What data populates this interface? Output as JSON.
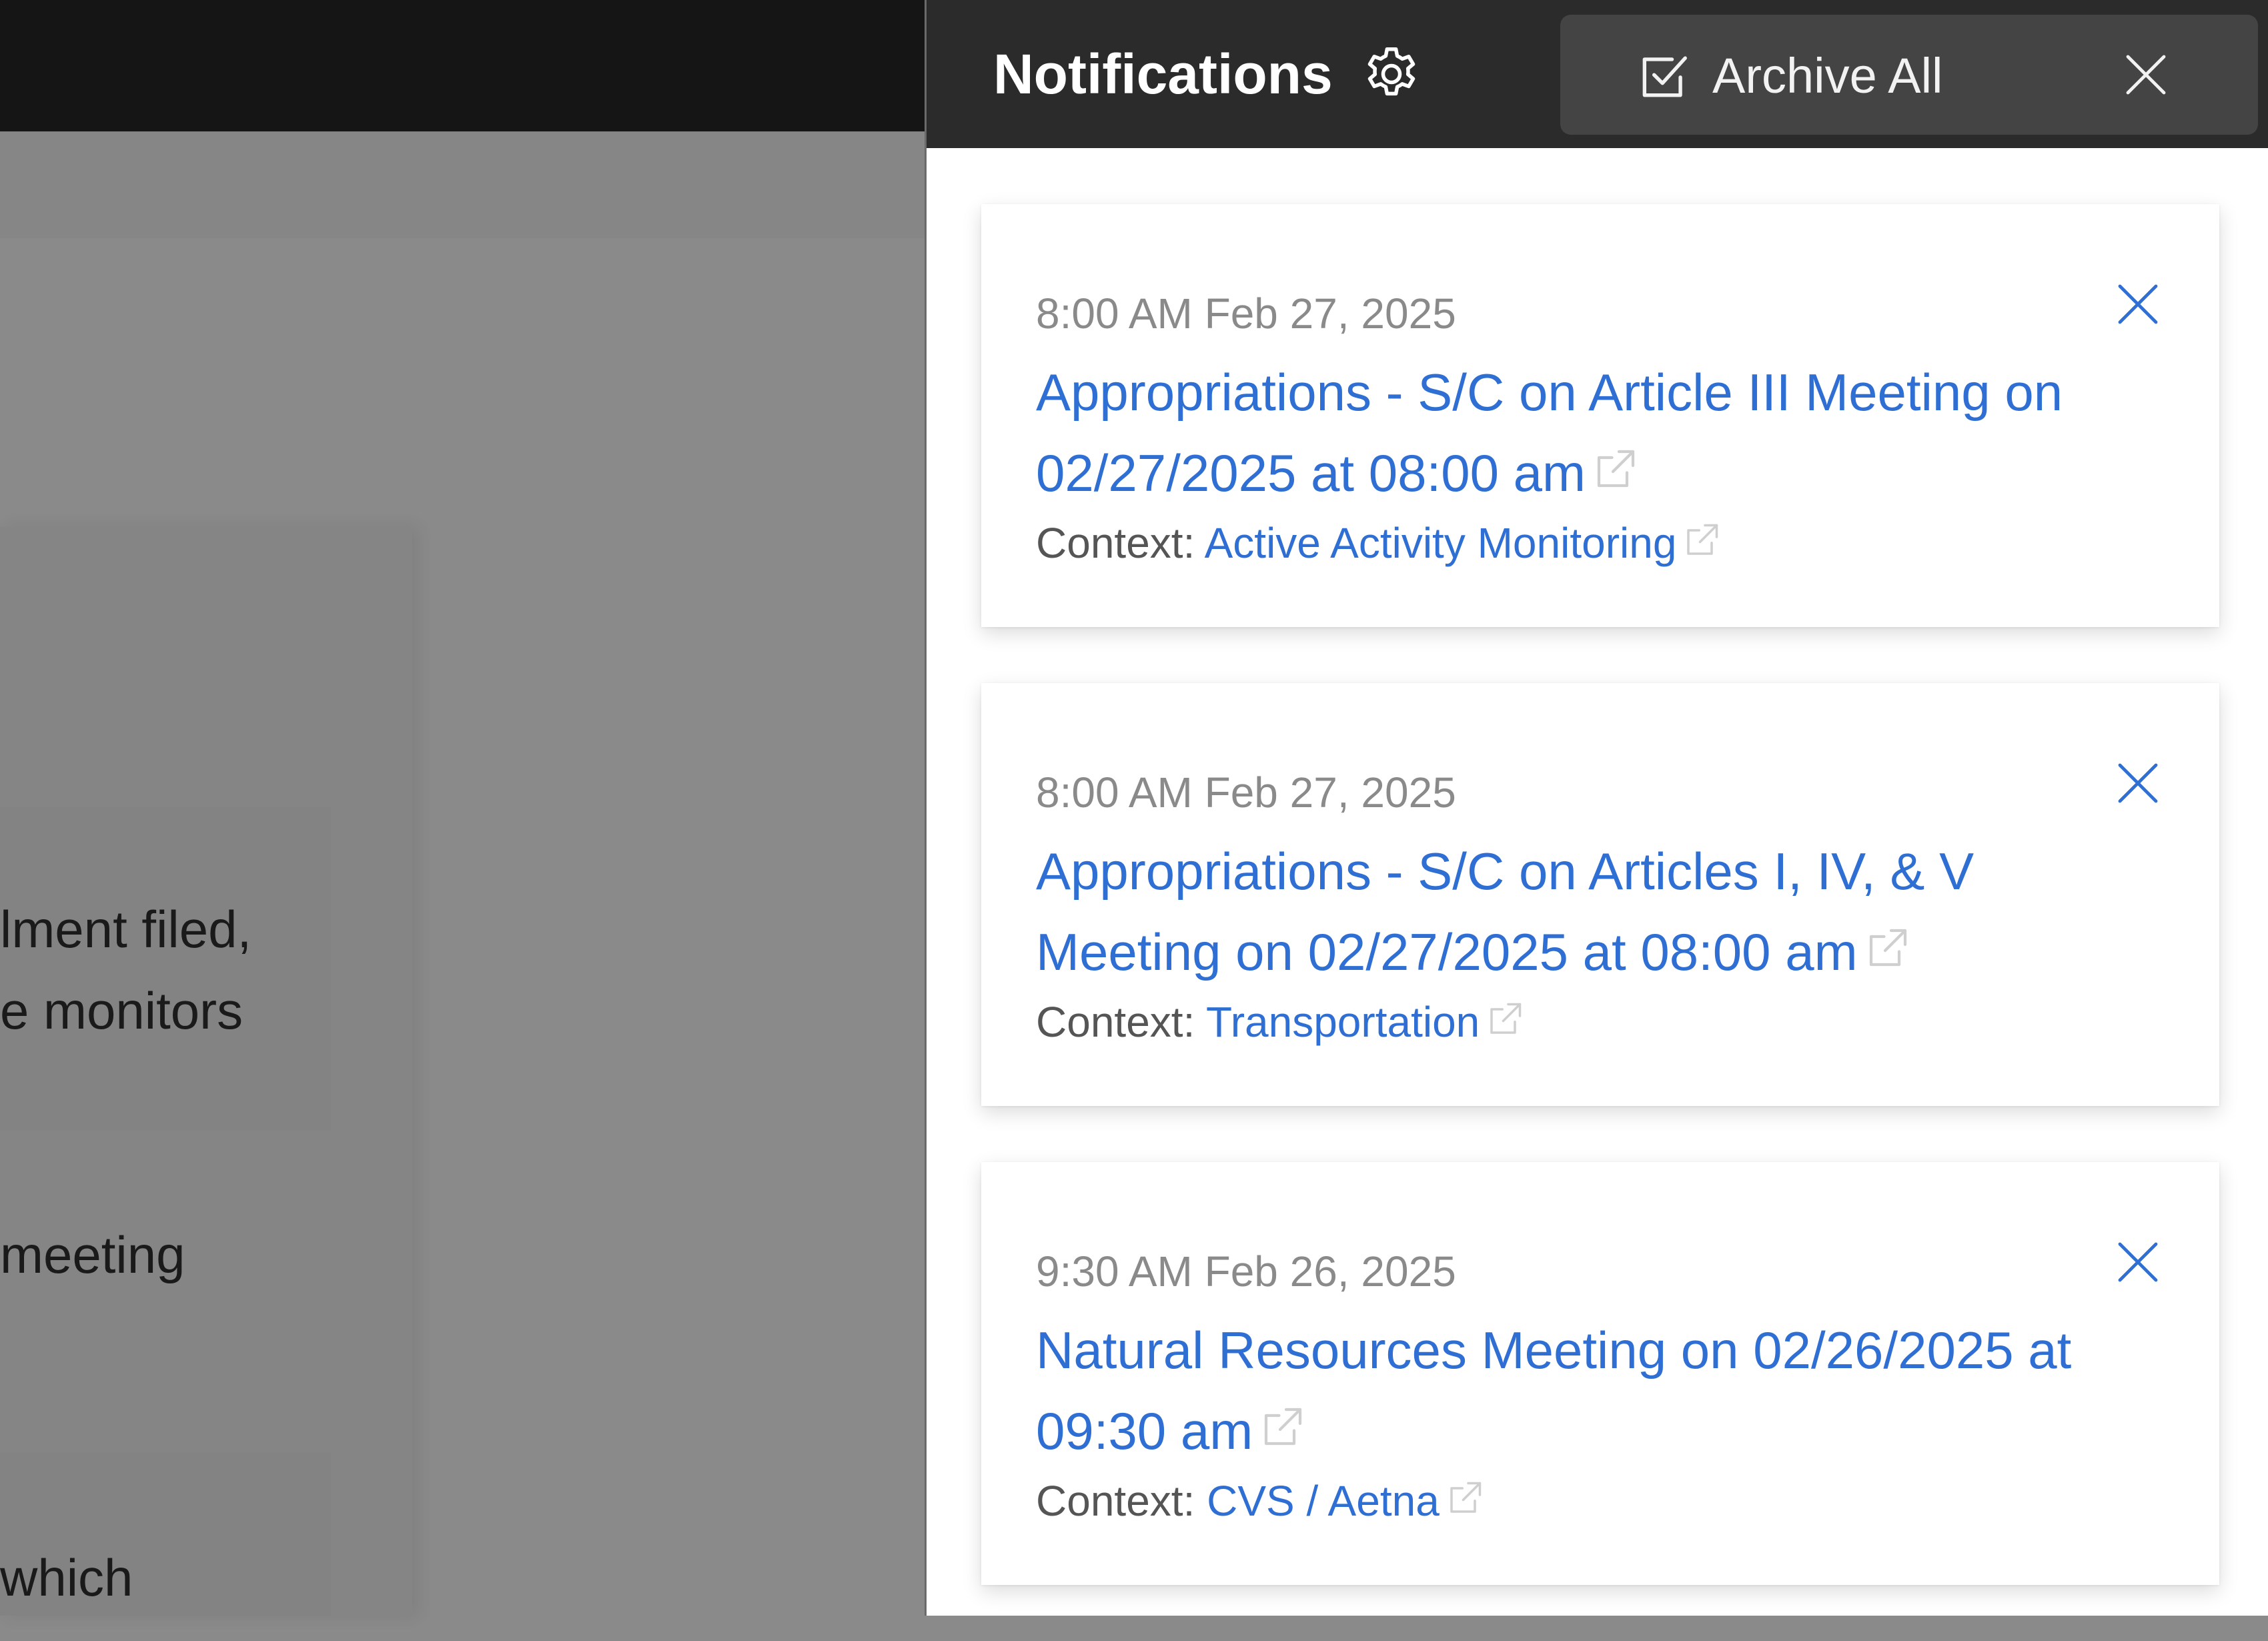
{
  "background": {
    "text_fragments": [
      "lment filed,",
      "e monitors",
      "meeting",
      "which"
    ]
  },
  "drawer": {
    "title": "Notifications",
    "settings_icon": "gear-icon",
    "archive_all_label": "Archive All",
    "archive_icon": "checkbox-check-icon",
    "close_icon": "close-icon"
  },
  "notifications": [
    {
      "time": "8:00 AM Feb 27, 2025",
      "title": "Appropriations - S/C on Article III Meeting on 02/27/2025 at 08:00 am",
      "context_label": "Context:",
      "context_value": "Active Activity Monitoring"
    },
    {
      "time": "8:00 AM Feb 27, 2025",
      "title": "Appropriations - S/C on Articles I, IV, & V Meeting on 02/27/2025 at 08:00 am",
      "context_label": "Context:",
      "context_value": "Transportation"
    },
    {
      "time": "9:30 AM Feb 26, 2025",
      "title": "Natural Resources Meeting on 02/26/2025 at 09:30 am",
      "context_label": "Context:",
      "context_value": "CVS / Aetna"
    }
  ],
  "colors": {
    "link": "#2f6fd4",
    "header": "#2b2b2b",
    "overlay": "#8a8a8a"
  }
}
